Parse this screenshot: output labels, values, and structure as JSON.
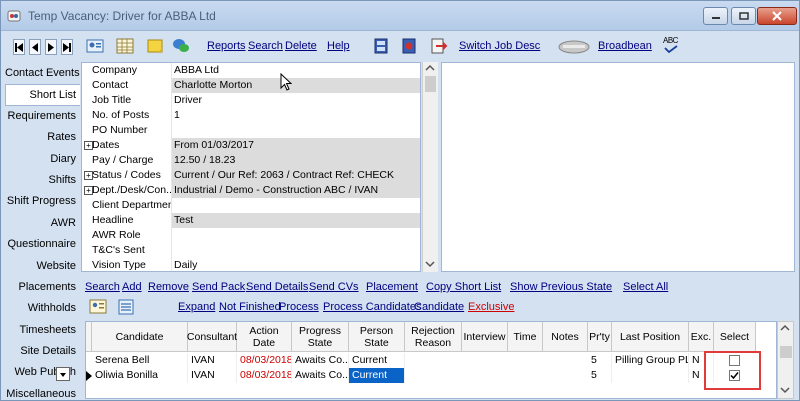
{
  "window": {
    "title": "Temp Vacancy: Driver for ABBA Ltd"
  },
  "toolbar": {
    "links": {
      "reports": "Reports",
      "search": "Search",
      "delete": "Delete",
      "help": "Help",
      "switch_job_desc": "Switch Job Desc",
      "broadbean": "Broadbean"
    },
    "abc_label": "ABC"
  },
  "nav": {
    "items": [
      "Contact Events",
      "Short List",
      "Requirements",
      "Rates",
      "Diary",
      "Shifts",
      "Shift Progress",
      "AWR",
      "Questionnaire",
      "Website",
      "Placements",
      "Withholds",
      "Timesheets",
      "Site Details",
      "Web Publish",
      "Miscellaneous"
    ],
    "active": "Short List"
  },
  "details": {
    "rows": [
      {
        "label": "Company",
        "value": "ABBA Ltd"
      },
      {
        "label": "Contact",
        "value": "Charlotte Morton"
      },
      {
        "label": "Job Title",
        "value": "Driver"
      },
      {
        "label": "No. of Posts",
        "value": "1"
      },
      {
        "label": "PO Number",
        "value": ""
      },
      {
        "label": "Dates",
        "value": "From 01/03/2017"
      },
      {
        "label": "Pay / Charge",
        "value": "12.50 / 18.23"
      },
      {
        "label": "Status / Codes",
        "value": "Current / Our Ref: 2063 / Contract Ref: CHECK"
      },
      {
        "label": "Dept./Desk/Con...",
        "value": "Industrial / Demo - Construction ABC / IVAN"
      },
      {
        "label": "Client Department",
        "value": ""
      },
      {
        "label": "Headline",
        "value": "Test"
      },
      {
        "label": "AWR Role",
        "value": ""
      },
      {
        "label": "T&C's Sent",
        "value": ""
      },
      {
        "label": "Vision Type",
        "value": "Daily"
      }
    ]
  },
  "actions_row1": {
    "search": "Search",
    "add": "Add",
    "remove": "Remove",
    "send_pack": "Send Pack",
    "send_details": "Send Details",
    "send_cvs": "Send CVs",
    "placement": "Placement",
    "copy_short_list": "Copy Short List",
    "show_previous_state": "Show Previous State",
    "select_all": "Select All"
  },
  "actions_row2": {
    "expand": "Expand",
    "not_finished": "Not Finished",
    "process": "Process",
    "process_candidates": "Process Candidates",
    "candidate": "Candidate",
    "exclusive": "Exclusive"
  },
  "grid": {
    "columns": [
      "Candidate",
      "Consultant",
      "Action Date",
      "Progress State",
      "Person State",
      "Rejection Reason",
      "Interview",
      "Time",
      "Notes",
      "Pr'ty",
      "Last Position",
      "Exc.",
      "Select"
    ],
    "rows": [
      {
        "candidate": "Serena Bell",
        "consultant": "IVAN",
        "action_date": "08/03/2018",
        "progress_state": "Awaits Co...",
        "person_state": "Current",
        "priority": "5",
        "last_position": "Pilling Group PL...",
        "exc": "N",
        "select": false
      },
      {
        "candidate": "Oliwia Bonilla",
        "consultant": "IVAN",
        "action_date": "08/03/2018",
        "progress_state": "Awaits Co...",
        "person_state": "Current",
        "priority": "5",
        "last_position": "",
        "exc": "N",
        "select": true
      }
    ]
  },
  "colors": {
    "accent": "#000080",
    "exclusive": "#cc0000",
    "highlight": "#e03a3a",
    "selected_cell": "#0a64c8"
  }
}
